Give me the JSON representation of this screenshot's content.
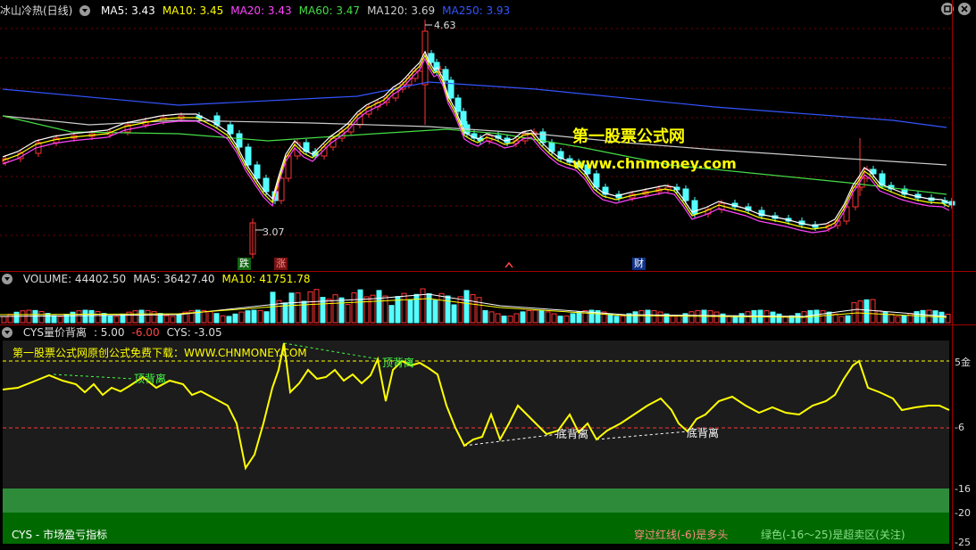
{
  "main_legend": {
    "title": "冰山冷热(日线)",
    "items": [
      {
        "label": "MA5: 3.43",
        "color": "#ffffff"
      },
      {
        "label": "MA10: 3.45",
        "color": "#ffff00"
      },
      {
        "label": "MA20: 3.43",
        "color": "#ff44ff"
      },
      {
        "label": "MA60: 3.47",
        "color": "#44dd44"
      },
      {
        "label": "MA120: 3.69",
        "color": "#cccccc"
      },
      {
        "label": "MA250: 3.93",
        "color": "#3355ff"
      }
    ]
  },
  "main_chart": {
    "high_label": "4.63",
    "low_label": "3.07",
    "watermark_title": "第一股票公式网",
    "watermark_url": "www.chnmoney.com",
    "markers": [
      {
        "text": "跌",
        "bg": "#116611",
        "color": "#ffffff"
      },
      {
        "text": "涨",
        "bg": "#771111",
        "color": "#ff8888"
      },
      {
        "text": "财",
        "bg": "#113388",
        "color": "#ffffff"
      }
    ],
    "colors": {
      "up": "#ff3333",
      "down": "#55ffff"
    }
  },
  "volume_legend": {
    "items": [
      {
        "label": "VOLUME: 44402.50",
        "color": "#dddddd"
      },
      {
        "label": "MA5: 36427.40",
        "color": "#dddddd"
      },
      {
        "label": "MA10: 41751.78",
        "color": "#ffff00"
      }
    ]
  },
  "cys_legend": {
    "items": [
      {
        "label": "CYS量价背离",
        "color": "#dddddd"
      },
      {
        "label": ": 5.00",
        "color": "#dddddd"
      },
      {
        "label": "-6.00",
        "color": "#ff4444"
      },
      {
        "label": "CYS: -3.05",
        "color": "#dddddd"
      }
    ]
  },
  "cys_panel": {
    "promo": "第一股票公式网原创公式免费下载：WWW.CHNMONEY.COM",
    "top_div_label_1": "顶背离",
    "top_div_label_2": "顶背离",
    "bottom_div_label_1": "底背离",
    "bottom_div_label_2": "底背离",
    "y_labels": [
      "5金",
      "-6",
      "-16",
      "-20",
      "-25"
    ],
    "footer_left": "CYS - 市场盈亏指标",
    "footer_mid": "穿过红线(-6)是多头",
    "footer_right": "绿色(-16～25)是超卖区(关注)"
  }
}
